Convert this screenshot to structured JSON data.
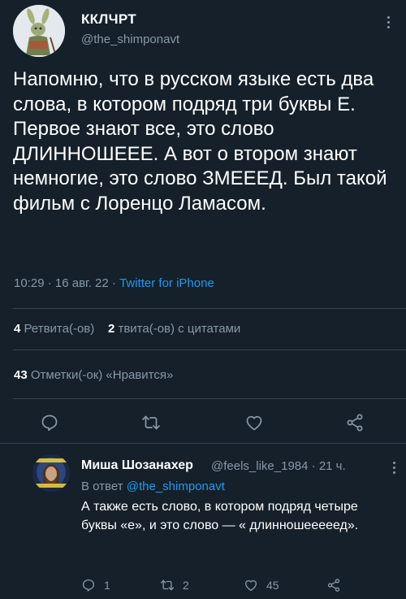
{
  "tweet": {
    "author_name": "ККЛЧРТ",
    "author_handle": "@the_shimponavt",
    "text": "Напомню, что в русском языке есть два слова, в котором подряд три буквы Е. Первое знают все, это слово ДЛИННОШЕЕЕ. А вот о втором знают немногие, это слово ЗМЕЕЕД. Был такой фильм с Лоренцо Ламасом.",
    "time": "10:29",
    "date": "16 авг. 22",
    "separator": "·",
    "source": "Twitter for iPhone"
  },
  "stats": {
    "retweets_count": "4",
    "retweets_label": "Ретвита(-ов)",
    "quotes_count": "2",
    "quotes_label": "твита(-ов) с цитатами",
    "likes_count": "43",
    "likes_label": "Отметки(-ок) «Нравится»"
  },
  "actions": {
    "reply_icon": "reply-icon",
    "retweet_icon": "retweet-icon",
    "like_icon": "heart-icon",
    "share_icon": "share-icon"
  },
  "reply": {
    "author_name": "Миша Шозанахер",
    "author_handle": "@feels_like_1984",
    "time_ago": "21 ч.",
    "separator": "·",
    "reply_to_label": "В ответ",
    "reply_to_handle": "@the_shimponavt",
    "text": "А также есть слово, в котором подряд четыре буквы «е», и это слово — « длинношееееед».",
    "replies_count": "1",
    "retweets_count": "2",
    "likes_count": "45"
  },
  "colors": {
    "background": "#15202b",
    "text_primary": "#ffffff",
    "text_secondary": "#8899a6",
    "link": "#1d9bf0",
    "divider": "#38444d"
  }
}
